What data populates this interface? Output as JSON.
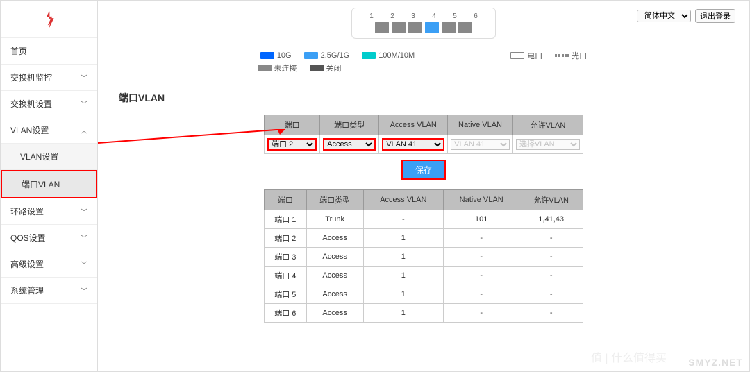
{
  "topbar": {
    "port_numbers": [
      "1",
      "2",
      "3",
      "4",
      "5",
      "6"
    ],
    "lang_options": [
      "简体中文"
    ],
    "logout": "退出登录"
  },
  "legend": {
    "l10g": "10G",
    "l25g": "2.5G/1G",
    "l100m": "100M/10M",
    "nolink": "未连接",
    "off": "关闭",
    "elec": "电口",
    "opt": "光口"
  },
  "sidebar": {
    "home": "首页",
    "monitor": "交换机监控",
    "switch_cfg": "交换机设置",
    "vlan_cfg": "VLAN设置",
    "vlan_cfg_sub": "VLAN设置",
    "port_vlan": "端口VLAN",
    "loop": "环路设置",
    "qos": "QOS设置",
    "adv": "高级设置",
    "sys": "系统管理"
  },
  "page": {
    "title": "端口VLAN"
  },
  "cfg_table": {
    "headers": {
      "port": "端口",
      "type": "端口类型",
      "access": "Access VLAN",
      "native": "Native VLAN",
      "allow": "允许VLAN"
    },
    "port_sel": "端口 2",
    "type_sel": "Access",
    "access_sel": "VLAN 41",
    "native_sel": "VLAN 41",
    "allow_sel": "选择VLAN",
    "save": "保存"
  },
  "status_table": {
    "headers": {
      "port": "端口",
      "type": "端口类型",
      "access": "Access VLAN",
      "native": "Native VLAN",
      "allow": "允许VLAN"
    },
    "rows": [
      {
        "port": "端口 1",
        "type": "Trunk",
        "access": "-",
        "native": "101",
        "allow": "1,41,43"
      },
      {
        "port": "端口 2",
        "type": "Access",
        "access": "1",
        "native": "-",
        "allow": "-"
      },
      {
        "port": "端口 3",
        "type": "Access",
        "access": "1",
        "native": "-",
        "allow": "-"
      },
      {
        "port": "端口 4",
        "type": "Access",
        "access": "1",
        "native": "-",
        "allow": "-"
      },
      {
        "port": "端口 5",
        "type": "Access",
        "access": "1",
        "native": "-",
        "allow": "-"
      },
      {
        "port": "端口 6",
        "type": "Access",
        "access": "1",
        "native": "-",
        "allow": "-"
      }
    ]
  },
  "watermark": {
    "brand": "SMYZ.NET",
    "slogan": "值 | 什么值得买"
  }
}
